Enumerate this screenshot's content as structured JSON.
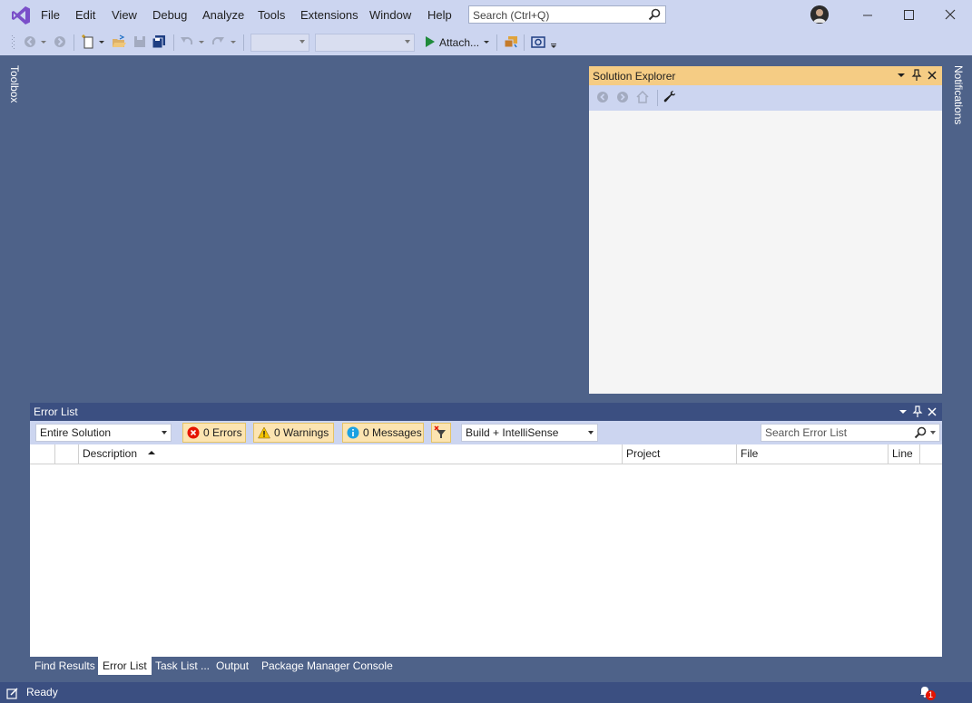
{
  "app": {
    "title": "Visual Studio"
  },
  "menu": [
    "File",
    "Edit",
    "View",
    "Debug",
    "Analyze",
    "Tools",
    "Extensions",
    "Window",
    "Help"
  ],
  "search": {
    "placeholder": "Search (Ctrl+Q)"
  },
  "toolbar": {
    "attach_label": "Attach..."
  },
  "side_tabs": {
    "toolbox": "Toolbox",
    "notifications": "Notifications"
  },
  "solution_explorer": {
    "title": "Solution Explorer"
  },
  "error_list": {
    "title": "Error List",
    "scope": "Entire Solution",
    "errors": "0 Errors",
    "warnings": "0 Warnings",
    "messages": "0 Messages",
    "source": "Build + IntelliSense",
    "search_placeholder": "Search Error List",
    "columns": [
      "Description",
      "Project",
      "File",
      "Line"
    ]
  },
  "bottom_tabs": [
    "Find Results",
    "Error List",
    "Task List ...",
    "Output",
    "Package Manager Console"
  ],
  "status": {
    "text": "Ready",
    "notification_count": "1"
  },
  "colors": {
    "accent": "#3b4f81",
    "header_highlight": "#f5cc84",
    "background": "#4e6289"
  }
}
